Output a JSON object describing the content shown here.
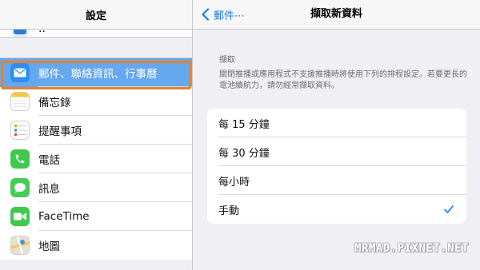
{
  "sidebar": {
    "title": "設定",
    "partial_item": "..",
    "items": [
      {
        "label": "郵件、聯絡資訊、行事曆",
        "icon": "mail-icon",
        "selected": true
      },
      {
        "label": "備忘錄",
        "icon": "notes-icon"
      },
      {
        "label": "提醒事項",
        "icon": "reminders-icon"
      },
      {
        "label": "電話",
        "icon": "phone-icon"
      },
      {
        "label": "訊息",
        "icon": "messages-icon"
      },
      {
        "label": "FaceTime",
        "icon": "facetime-icon"
      },
      {
        "label": "地圖",
        "icon": "maps-icon"
      }
    ]
  },
  "detail": {
    "back_label": "郵件⋯",
    "title": "擷取新資料",
    "section_header": "擷取",
    "section_description": "關閉推播或應用程式不支援推播時將使用下列的排程設定。若要更長的電池續航力，請勿經常擷取資料。",
    "options": [
      {
        "label": "每 15 分鐘",
        "checked": false
      },
      {
        "label": "每 30 分鐘",
        "checked": false
      },
      {
        "label": "每小時",
        "checked": false
      },
      {
        "label": "手動",
        "checked": true
      }
    ]
  },
  "watermark": "MRMAD.PIXNET.NET",
  "colors": {
    "accent": "#1a7bf2",
    "selected_row": "#66a8f0",
    "highlight_border": "#e8822a",
    "background": "#efeff4"
  }
}
